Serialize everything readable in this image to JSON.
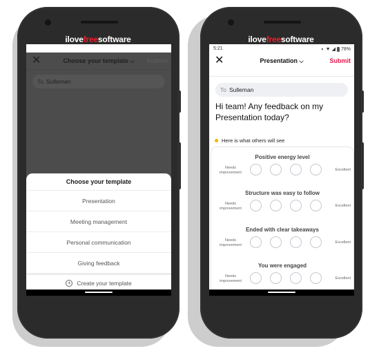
{
  "brand": {
    "prefix": "ilove",
    "accent": "free",
    "suffix": "software",
    "accent_color": "#e8202a"
  },
  "left_phone": {
    "header": {
      "close_icon": "close-icon",
      "title": "Choose your template",
      "dropdown_icon": "chevron-down-icon",
      "submit_label": "Submit"
    },
    "to_field": {
      "label": "To",
      "value": "Sulleman"
    },
    "sheet": {
      "title": "Choose your template",
      "items": [
        {
          "label": "Presentation"
        },
        {
          "label": "Meeting management"
        },
        {
          "label": "Personal communication"
        },
        {
          "label": "Giving feedback"
        }
      ],
      "create": {
        "icon": "plus-circle-icon",
        "label": "Create your template"
      }
    }
  },
  "right_phone": {
    "status": {
      "time": "5:21",
      "battery": "78%"
    },
    "header": {
      "close_icon": "close-icon",
      "title": "Presentation",
      "dropdown_icon": "chevron-down-icon",
      "submit_label": "Submit",
      "submit_color": "#e8174c"
    },
    "to_field": {
      "label": "To",
      "value": "Sulleman"
    },
    "message": "Hi team! Any feedback on my Presentation today?",
    "preview_note": "Here is what others will see",
    "questions": [
      {
        "title": "Positive energy level",
        "low_label": "Needs improvement",
        "high_label": "Excellent",
        "options": 4
      },
      {
        "title": "Structure was easy to follow",
        "low_label": "Needs improvement",
        "high_label": "Excellent",
        "options": 4
      },
      {
        "title": "Ended with clear takeaways",
        "low_label": "Needs improvement",
        "high_label": "Excellent",
        "options": 4
      },
      {
        "title": "You were engaged",
        "low_label": "Needs improvement",
        "high_label": "Excellent",
        "options": 4
      }
    ]
  }
}
